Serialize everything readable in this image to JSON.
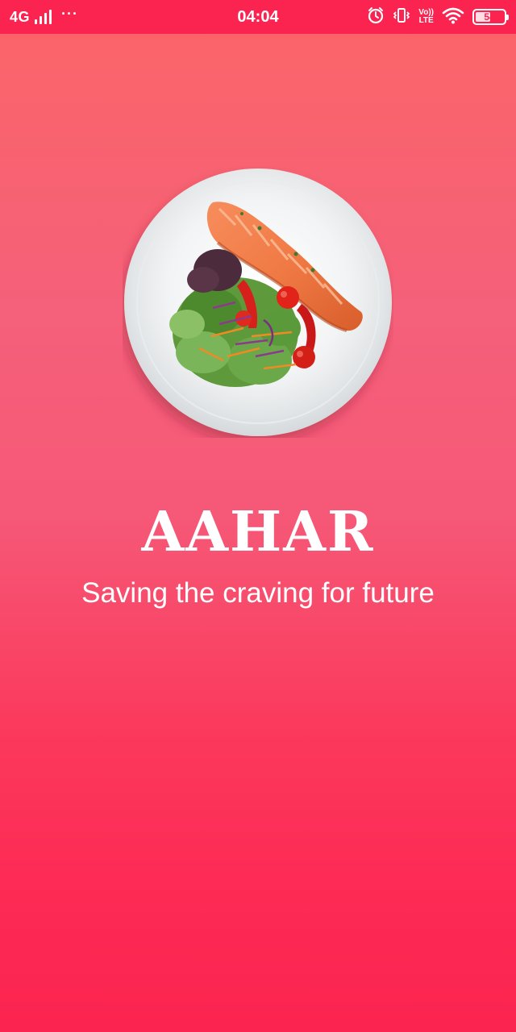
{
  "status_bar": {
    "network": "4G",
    "signal_bars": 4,
    "more_dots": "···",
    "time": "04:04",
    "volte_top": "Vo))",
    "volte_bottom": "LTE",
    "battery_percent": 54,
    "battery_text": "54",
    "icons": [
      "alarm-icon",
      "vibrate-icon",
      "volte-icon",
      "wifi-icon",
      "battery-icon"
    ]
  },
  "splash": {
    "image": "salmon-salad-plate",
    "title": "AAHAR",
    "tagline": "Saving the craving for future"
  },
  "colors": {
    "status_bar_bg": "#fb2450",
    "gradient_top": "#fb6567",
    "gradient_bottom": "#fb2450",
    "text": "#ffffff"
  }
}
